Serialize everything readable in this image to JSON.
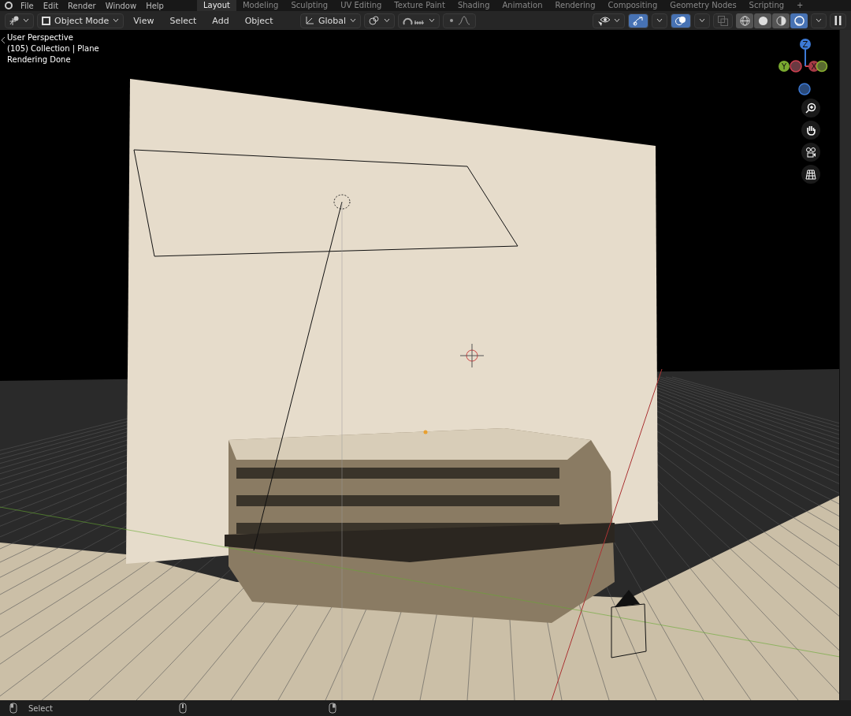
{
  "menu": [
    "File",
    "Edit",
    "Render",
    "Window",
    "Help"
  ],
  "workspaces": [
    {
      "label": "Layout",
      "selected": true
    },
    {
      "label": "Modeling",
      "selected": false
    },
    {
      "label": "Sculpting",
      "selected": false
    },
    {
      "label": "UV Editing",
      "selected": false
    },
    {
      "label": "Texture Paint",
      "selected": false
    },
    {
      "label": "Shading",
      "selected": false
    },
    {
      "label": "Animation",
      "selected": false
    },
    {
      "label": "Rendering",
      "selected": false
    },
    {
      "label": "Compositing",
      "selected": false
    },
    {
      "label": "Geometry Nodes",
      "selected": false
    },
    {
      "label": "Scripting",
      "selected": false
    }
  ],
  "add_workspace": "+",
  "header": {
    "mode": "Object Mode",
    "menus": [
      "View",
      "Select",
      "Add",
      "Object"
    ],
    "orientation": "Global",
    "gizmos_on": true,
    "overlays_on": true
  },
  "shading": [
    {
      "kind": "wireframe",
      "selected": false
    },
    {
      "kind": "solid",
      "selected": false
    },
    {
      "kind": "material",
      "selected": false
    },
    {
      "kind": "rendered",
      "selected": true
    }
  ],
  "overlay_text": [
    "User Perspective",
    "(105) Collection | Plane",
    "Rendering Done"
  ],
  "gizmo": {
    "z": "Z",
    "y": "Y",
    "x": "X"
  },
  "status_bar": {
    "hint": "Select"
  }
}
